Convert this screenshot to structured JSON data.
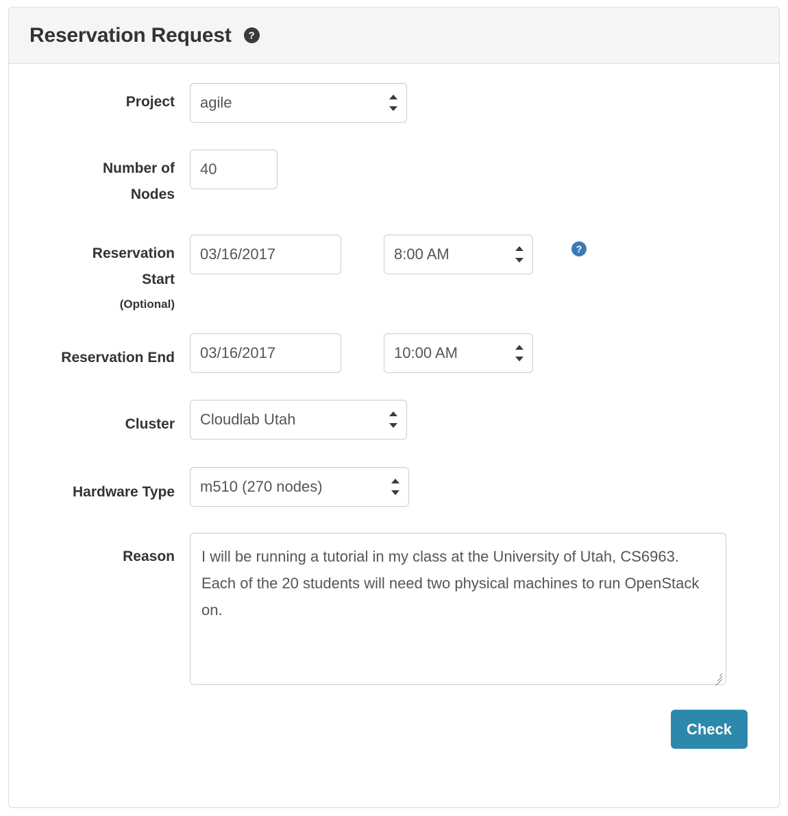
{
  "panel": {
    "title": "Reservation Request",
    "title_help_icon": "question-circle-icon",
    "accent_color": "#2d89ab",
    "help_blue_color": "#3b7ab5",
    "help_dark_color": "#3a3a3a"
  },
  "form": {
    "project": {
      "label": "Project",
      "value": "agile",
      "options": [
        "agile"
      ]
    },
    "number_of_nodes": {
      "label_line1": "Number of",
      "label_line2": "Nodes",
      "value": "40",
      "placeholder": ""
    },
    "reservation_start": {
      "label_line1": "Reservation",
      "label_line2": "Start",
      "label_optional": "(Optional)",
      "date_value": "03/16/2017",
      "date_placeholder": "",
      "time_value": "8:00 AM",
      "time_options": [
        "8:00 AM"
      ],
      "help_icon": "question-circle-icon"
    },
    "reservation_end": {
      "label": "Reservation End",
      "date_value": "03/16/2017",
      "date_placeholder": "",
      "time_value": "10:00 AM",
      "time_options": [
        "10:00 AM"
      ]
    },
    "cluster": {
      "label": "Cluster",
      "value": "Cloudlab Utah",
      "options": [
        "Cloudlab Utah"
      ]
    },
    "hardware_type": {
      "label": "Hardware Type",
      "value": "m510 (270 nodes)",
      "options": [
        "m510 (270 nodes)"
      ]
    },
    "reason": {
      "label": "Reason",
      "value": "I will be running a tutorial in my class at the University of Utah, CS6963. Each of the 20 students will need two physical machines to run OpenStack on.",
      "placeholder": ""
    },
    "submit": {
      "label": "Check"
    }
  }
}
